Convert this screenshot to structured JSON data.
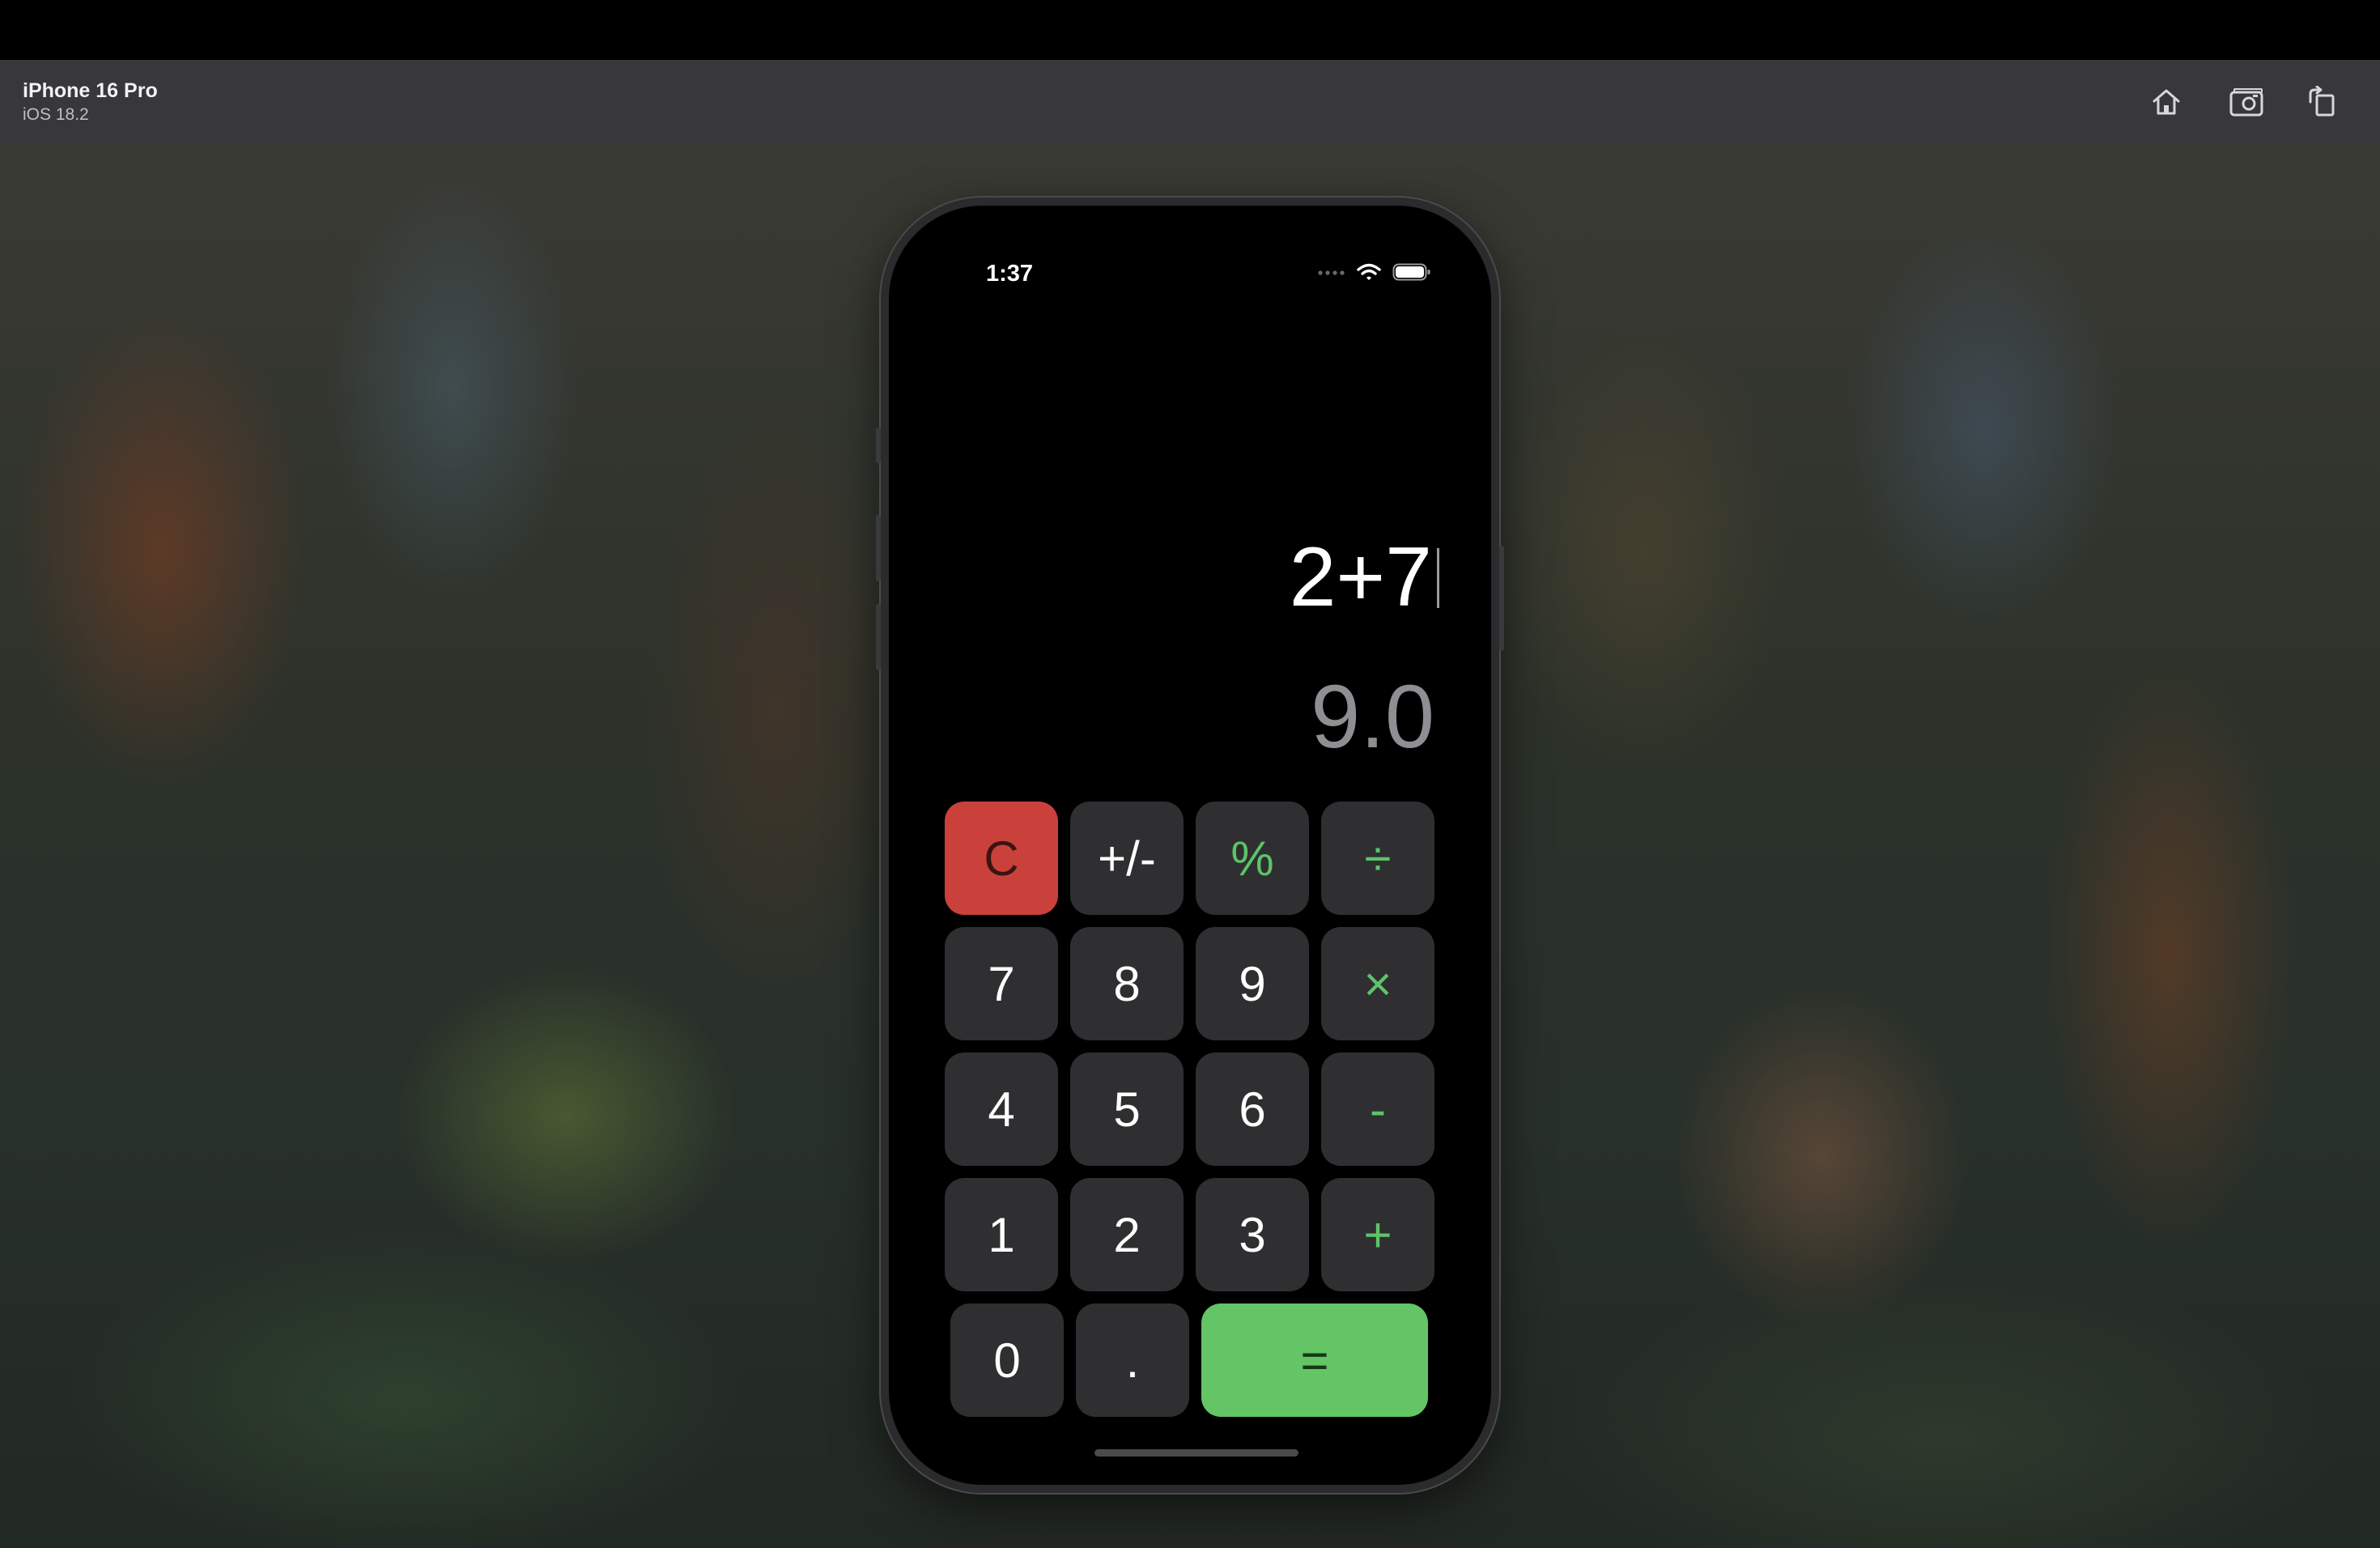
{
  "toolbar": {
    "device_name": "iPhone 16 Pro",
    "os_version": "iOS 18.2",
    "icons": [
      "home-icon",
      "screenshot-icon",
      "rotate-icon"
    ]
  },
  "status_bar": {
    "time": "1:37",
    "icons": [
      "cellular-dots-icon",
      "wifi-icon",
      "battery-icon"
    ]
  },
  "display": {
    "expression": "2+7",
    "result": "9.0"
  },
  "keys": {
    "clear": "C",
    "sign": "+/-",
    "percent": "%",
    "divide": "÷",
    "seven": "7",
    "eight": "8",
    "nine": "9",
    "multiply": "×",
    "four": "4",
    "five": "5",
    "six": "6",
    "subtract": "-",
    "one": "1",
    "two": "2",
    "three": "3",
    "add": "+",
    "zero": "0",
    "decimal": ".",
    "equals": "="
  },
  "colors": {
    "clear_key": "#c9413a",
    "equals_key": "#64c566",
    "operator_text": "#5cc46a",
    "key_background": "#2f2f31",
    "result_text": "#8e8e93"
  }
}
